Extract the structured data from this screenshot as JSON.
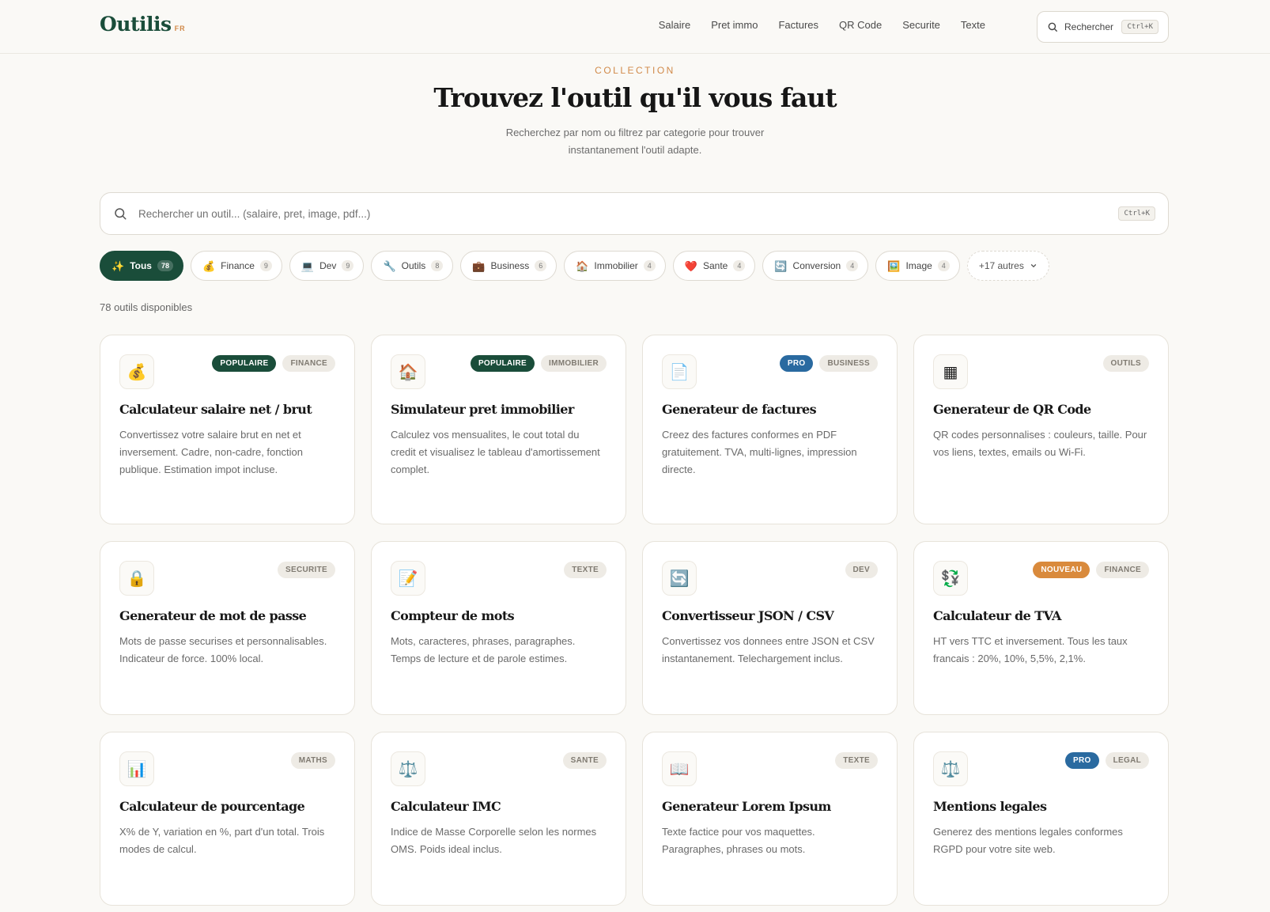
{
  "header": {
    "logo": "Outilis",
    "logo_suffix": "FR",
    "nav": [
      "Salaire",
      "Pret immo",
      "Factures",
      "QR Code",
      "Securite",
      "Texte"
    ],
    "search_label": "Rechercher",
    "search_shortcut": "Ctrl+K"
  },
  "hero": {
    "eyebrow": "COLLECTION",
    "title": "Trouvez l'outil qu'il vous faut",
    "subtitle": "Recherchez par nom ou filtrez par categorie pour trouver instantanement l'outil adapte."
  },
  "search": {
    "placeholder": "Rechercher un outil... (salaire, pret, image, pdf...)",
    "value": "",
    "shortcut": "Ctrl+K"
  },
  "filters": [
    {
      "icon": "✨",
      "label": "Tous",
      "count": "78",
      "active": true
    },
    {
      "icon": "💰",
      "label": "Finance",
      "count": "9"
    },
    {
      "icon": "💻",
      "label": "Dev",
      "count": "9"
    },
    {
      "icon": "🔧",
      "label": "Outils",
      "count": "8"
    },
    {
      "icon": "💼",
      "label": "Business",
      "count": "6"
    },
    {
      "icon": "🏠",
      "label": "Immobilier",
      "count": "4"
    },
    {
      "icon": "❤️",
      "label": "Sante",
      "count": "4"
    },
    {
      "icon": "🔄",
      "label": "Conversion",
      "count": "4"
    },
    {
      "icon": "🖼️",
      "label": "Image",
      "count": "4"
    }
  ],
  "more_filters": "+17 autres",
  "tool_count_text": "78 outils disponibles",
  "tools": [
    {
      "icon": "💰",
      "icon_name": "money-bag-icon",
      "badges": [
        {
          "text": "POPULAIRE",
          "kind": "pop"
        },
        {
          "text": "FINANCE",
          "kind": "cat"
        }
      ],
      "title": "Calculateur salaire net / brut",
      "desc": "Convertissez votre salaire brut en net et inversement. Cadre, non-cadre, fonction publique. Estimation impot incluse."
    },
    {
      "icon": "🏠",
      "icon_name": "house-icon",
      "badges": [
        {
          "text": "POPULAIRE",
          "kind": "pop"
        },
        {
          "text": "IMMOBILIER",
          "kind": "cat"
        }
      ],
      "title": "Simulateur pret immobilier",
      "desc": "Calculez vos mensualites, le cout total du credit et visualisez le tableau d'amortissement complet."
    },
    {
      "icon": "📄",
      "icon_name": "document-icon",
      "badges": [
        {
          "text": "PRO",
          "kind": "pro"
        },
        {
          "text": "BUSINESS",
          "kind": "cat"
        }
      ],
      "title": "Generateur de factures",
      "desc": "Creez des factures conformes en PDF gratuitement. TVA, multi-lignes, impression directe."
    },
    {
      "icon": "▦",
      "icon_name": "qr-code-icon",
      "badges": [
        {
          "text": "OUTILS",
          "kind": "cat"
        }
      ],
      "title": "Generateur de QR Code",
      "desc": "QR codes personnalises : couleurs, taille. Pour vos liens, textes, emails ou Wi-Fi."
    },
    {
      "icon": "🔒",
      "icon_name": "lock-icon",
      "badges": [
        {
          "text": "SECURITE",
          "kind": "cat"
        }
      ],
      "title": "Generateur de mot de passe",
      "desc": "Mots de passe securises et personnalisables. Indicateur de force. 100% local."
    },
    {
      "icon": "📝",
      "icon_name": "memo-icon",
      "badges": [
        {
          "text": "TEXTE",
          "kind": "cat"
        }
      ],
      "title": "Compteur de mots",
      "desc": "Mots, caracteres, phrases, paragraphes. Temps de lecture et de parole estimes."
    },
    {
      "icon": "🔄",
      "icon_name": "convert-icon",
      "badges": [
        {
          "text": "DEV",
          "kind": "cat"
        }
      ],
      "title": "Convertisseur JSON / CSV",
      "desc": "Convertissez vos donnees entre JSON et CSV instantanement. Telechargement inclus."
    },
    {
      "icon": "💱",
      "icon_name": "currency-exchange-icon",
      "badges": [
        {
          "text": "NOUVEAU",
          "kind": "new"
        },
        {
          "text": "FINANCE",
          "kind": "cat"
        }
      ],
      "title": "Calculateur de TVA",
      "desc": "HT vers TTC et inversement. Tous les taux francais : 20%, 10%, 5,5%, 2,1%."
    },
    {
      "icon": "📊",
      "icon_name": "bar-chart-icon",
      "badges": [
        {
          "text": "MATHS",
          "kind": "cat"
        }
      ],
      "title": "Calculateur de pourcentage",
      "desc": "X% de Y, variation en %, part d'un total. Trois modes de calcul."
    },
    {
      "icon": "⚖️",
      "icon_name": "scales-icon",
      "badges": [
        {
          "text": "SANTE",
          "kind": "cat"
        }
      ],
      "title": "Calculateur IMC",
      "desc": "Indice de Masse Corporelle selon les normes OMS. Poids ideal inclus."
    },
    {
      "icon": "📖",
      "icon_name": "open-book-icon",
      "badges": [
        {
          "text": "TEXTE",
          "kind": "cat"
        }
      ],
      "title": "Generateur Lorem Ipsum",
      "desc": "Texte factice pour vos maquettes. Paragraphes, phrases ou mots."
    },
    {
      "icon": "⚖️",
      "icon_name": "scales-icon",
      "badges": [
        {
          "text": "PRO",
          "kind": "pro"
        },
        {
          "text": "LEGAL",
          "kind": "cat"
        }
      ],
      "title": "Mentions legales",
      "desc": "Generez des mentions legales conformes RGPD pour votre site web."
    }
  ],
  "colors": {
    "brand": "#1a4d3a",
    "accent": "#d18a4a",
    "pro": "#2a6aa0",
    "new": "#d98a3c",
    "background": "#faf9f6"
  }
}
